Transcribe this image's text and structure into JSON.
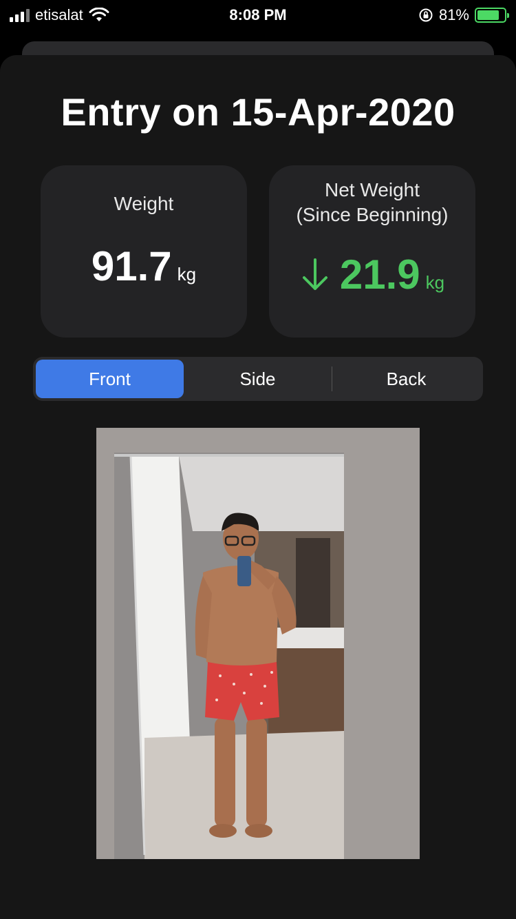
{
  "status_bar": {
    "carrier": "etisalat",
    "time": "8:08 PM",
    "battery_percent": "81%",
    "battery_level": 0.81,
    "battery_color": "#4cd964"
  },
  "entry": {
    "title": "Entry on 15-Apr-2020"
  },
  "weight_card": {
    "label": "Weight",
    "value": "91.7",
    "unit": "kg"
  },
  "net_weight_card": {
    "label_line1": "Net Weight",
    "label_line2": "(Since Beginning)",
    "value": "21.9",
    "unit": "kg",
    "direction_icon": "arrow-down-icon",
    "accent_color": "#4cc75f"
  },
  "segmented_control": {
    "options": [
      "Front",
      "Side",
      "Back"
    ],
    "selected": "Front",
    "active_color": "#3f7ae6"
  },
  "photo": {
    "view": "Front"
  }
}
